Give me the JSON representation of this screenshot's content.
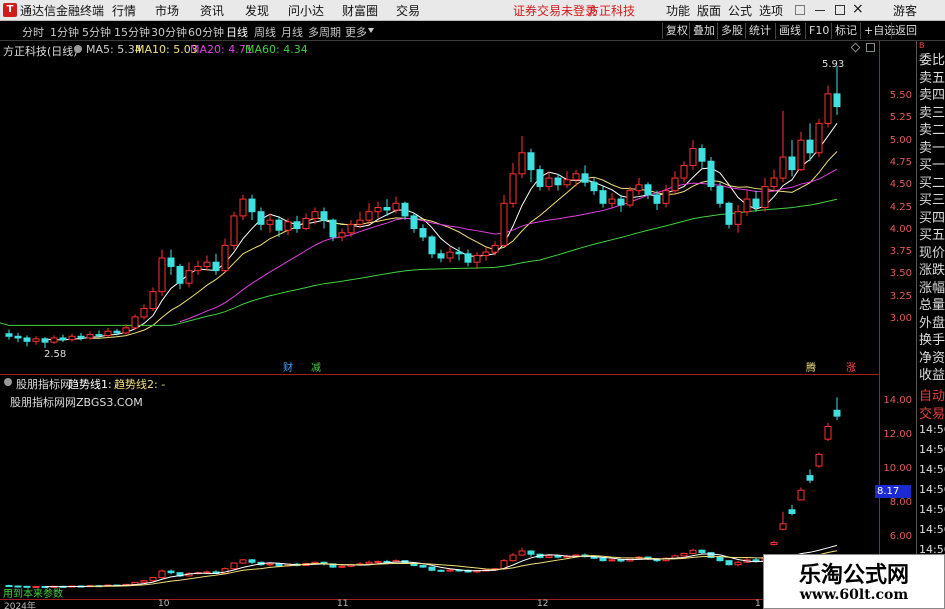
{
  "app": {
    "title": "通达信金融终端",
    "menu": [
      "行情",
      "市场",
      "资讯",
      "发现",
      "问小达",
      "财富圈",
      "交易"
    ],
    "warning": "证券交易未登录",
    "broker": "方正科技",
    "right_menu": [
      "功能",
      "版面",
      "公式",
      "选项"
    ],
    "user": "游客"
  },
  "toolbar": {
    "periods": [
      "分时",
      "1分钟",
      "5分钟",
      "15分钟",
      "30分钟",
      "60分钟",
      "日线",
      "周线",
      "月线",
      "多周期",
      "更多"
    ],
    "active": "日线",
    "buttons": [
      "复权",
      "叠加",
      "多股",
      "统计",
      "画线",
      "F10",
      "标记",
      "+自选",
      "返回"
    ]
  },
  "main": {
    "stock_label": "方正科技(日线)",
    "ma": [
      {
        "label": "MA5: 5.34",
        "color": "#ffffff"
      },
      {
        "label": "MA10: 5.03",
        "color": "#f2e07a"
      },
      {
        "label": "MA20: 4.71",
        "color": "#e040e0"
      },
      {
        "label": "MA60: 4.34",
        "color": "#40d040"
      }
    ],
    "high_label": "5.93",
    "low_label": "2.58",
    "markers": [
      {
        "text": "财",
        "color": "#40a0ff"
      },
      {
        "text": "减",
        "color": "#40d040"
      },
      {
        "text": "腾",
        "color": "#f2e07a"
      },
      {
        "text": "涨",
        "color": "#ff5050"
      }
    ],
    "yticks": [
      "5.50",
      "5.25",
      "5.00",
      "4.75",
      "4.50",
      "4.25",
      "4.00",
      "3.75",
      "3.50",
      "3.25",
      "3.00"
    ]
  },
  "sub": {
    "indicator": "股朋指标网",
    "line1": "趋势线1: -",
    "line2": "趋势线2: -",
    "site": "股朋指标网网ZBGS3.COM",
    "value_tag": "8.17",
    "yticks": [
      "14.00",
      "12.00",
      "10.00",
      "8.00",
      "6.00"
    ],
    "bottom_text": "用到本来参数"
  },
  "dates": [
    "2024年",
    "10",
    "11",
    "12",
    "1"
  ],
  "right_panel": {
    "items": [
      "委比",
      "卖五",
      "卖四",
      "卖三",
      "卖二",
      "卖一",
      "买一",
      "买二",
      "买三",
      "买四",
      "买五",
      "现价",
      "涨跌",
      "涨幅",
      "总量",
      "外盘",
      "换手",
      "净资",
      "收益"
    ],
    "lower": [
      "自动",
      "交易"
    ],
    "times": [
      "14:56",
      "14:56",
      "14:56",
      "14:56",
      "14:56",
      "14:56",
      "14:56",
      "14:56"
    ]
  },
  "watermark": {
    "title": "乐淘公式网",
    "url": "www.60lt.com"
  },
  "chart_data": {
    "type": "candlestick",
    "colors": {
      "up": "#ff3030",
      "down": "#40e0e0"
    },
    "candles": [
      [
        2.75,
        2.72,
        2.8,
        2.68
      ],
      [
        2.72,
        2.7,
        2.76,
        2.65
      ],
      [
        2.7,
        2.66,
        2.73,
        2.6
      ],
      [
        2.66,
        2.69,
        2.72,
        2.62
      ],
      [
        2.69,
        2.65,
        2.71,
        2.58
      ],
      [
        2.65,
        2.7,
        2.73,
        2.63
      ],
      [
        2.7,
        2.68,
        2.74,
        2.65
      ],
      [
        2.68,
        2.72,
        2.75,
        2.66
      ],
      [
        2.72,
        2.7,
        2.76,
        2.67
      ],
      [
        2.7,
        2.74,
        2.78,
        2.68
      ],
      [
        2.74,
        2.73,
        2.79,
        2.7
      ],
      [
        2.73,
        2.78,
        2.82,
        2.71
      ],
      [
        2.78,
        2.76,
        2.81,
        2.73
      ],
      [
        2.76,
        2.82,
        2.86,
        2.74
      ],
      [
        2.82,
        2.95,
        2.98,
        2.8
      ],
      [
        2.95,
        3.05,
        3.1,
        2.92
      ],
      [
        3.05,
        3.25,
        3.3,
        3.02
      ],
      [
        3.25,
        3.65,
        3.75,
        3.2
      ],
      [
        3.65,
        3.55,
        3.75,
        3.45
      ],
      [
        3.55,
        3.35,
        3.58,
        3.28
      ],
      [
        3.35,
        3.5,
        3.6,
        3.3
      ],
      [
        3.5,
        3.55,
        3.62,
        3.45
      ],
      [
        3.55,
        3.6,
        3.68,
        3.5
      ],
      [
        3.6,
        3.5,
        3.7,
        3.45
      ],
      [
        3.5,
        3.8,
        3.88,
        3.48
      ],
      [
        3.8,
        4.15,
        4.2,
        3.75
      ],
      [
        4.15,
        4.35,
        4.4,
        4.1
      ],
      [
        4.35,
        4.2,
        4.4,
        4.1
      ],
      [
        4.2,
        4.05,
        4.25,
        3.98
      ],
      [
        4.05,
        4.1,
        4.18,
        3.95
      ],
      [
        4.1,
        3.98,
        4.15,
        3.9
      ],
      [
        3.98,
        4.08,
        4.12,
        3.92
      ],
      [
        4.08,
        4.0,
        4.15,
        3.95
      ],
      [
        4.0,
        4.12,
        4.18,
        3.98
      ],
      [
        4.12,
        4.2,
        4.25,
        4.05
      ],
      [
        4.2,
        4.1,
        4.25,
        4.0
      ],
      [
        4.1,
        3.9,
        4.12,
        3.85
      ],
      [
        3.9,
        3.95,
        4.0,
        3.85
      ],
      [
        3.95,
        4.05,
        4.1,
        3.9
      ],
      [
        4.05,
        4.1,
        4.2,
        4.0
      ],
      [
        4.1,
        4.2,
        4.3,
        4.05
      ],
      [
        4.2,
        4.25,
        4.32,
        4.12
      ],
      [
        4.25,
        4.22,
        4.35,
        4.15
      ],
      [
        4.22,
        4.3,
        4.38,
        4.18
      ],
      [
        4.3,
        4.15,
        4.32,
        4.1
      ],
      [
        4.15,
        4.0,
        4.18,
        3.95
      ],
      [
        4.0,
        3.9,
        4.05,
        3.85
      ],
      [
        3.9,
        3.7,
        3.92,
        3.65
      ],
      [
        3.7,
        3.65,
        3.75,
        3.6
      ],
      [
        3.65,
        3.72,
        3.78,
        3.6
      ],
      [
        3.72,
        3.7,
        3.78,
        3.62
      ],
      [
        3.7,
        3.6,
        3.75,
        3.55
      ],
      [
        3.6,
        3.68,
        3.72,
        3.52
      ],
      [
        3.68,
        3.72,
        3.78,
        3.62
      ],
      [
        3.72,
        3.8,
        3.85,
        3.68
      ],
      [
        3.8,
        4.3,
        4.4,
        3.78
      ],
      [
        4.3,
        4.65,
        4.78,
        4.25
      ],
      [
        4.65,
        4.9,
        5.1,
        4.6
      ],
      [
        4.9,
        4.7,
        4.95,
        4.55
      ],
      [
        4.7,
        4.5,
        4.75,
        4.45
      ],
      [
        4.5,
        4.6,
        4.68,
        4.45
      ],
      [
        4.6,
        4.52,
        4.65,
        4.45
      ],
      [
        4.52,
        4.58,
        4.68,
        4.48
      ],
      [
        4.58,
        4.65,
        4.7,
        4.5
      ],
      [
        4.65,
        4.55,
        4.75,
        4.5
      ],
      [
        4.55,
        4.45,
        4.6,
        4.4
      ],
      [
        4.45,
        4.3,
        4.5,
        4.25
      ],
      [
        4.3,
        4.35,
        4.42,
        4.25
      ],
      [
        4.35,
        4.28,
        4.4,
        4.2
      ],
      [
        4.28,
        4.45,
        4.5,
        4.25
      ],
      [
        4.45,
        4.52,
        4.6,
        4.4
      ],
      [
        4.52,
        4.4,
        4.55,
        4.35
      ],
      [
        4.4,
        4.3,
        4.45,
        4.22
      ],
      [
        4.3,
        4.45,
        4.52,
        4.25
      ],
      [
        4.45,
        4.6,
        4.68,
        4.4
      ],
      [
        4.6,
        4.75,
        4.8,
        4.55
      ],
      [
        4.75,
        4.95,
        5.05,
        4.7
      ],
      [
        4.95,
        4.8,
        5.0,
        4.72
      ],
      [
        4.8,
        4.5,
        4.85,
        4.45
      ],
      [
        4.5,
        4.3,
        4.55,
        4.25
      ],
      [
        4.3,
        4.05,
        4.32,
        4.0
      ],
      [
        4.05,
        4.2,
        4.28,
        3.95
      ],
      [
        4.2,
        4.35,
        4.45,
        4.15
      ],
      [
        4.35,
        4.25,
        4.45,
        4.2
      ],
      [
        4.25,
        4.5,
        4.6,
        4.2
      ],
      [
        4.5,
        4.6,
        4.7,
        4.45
      ],
      [
        4.6,
        4.85,
        5.4,
        4.55
      ],
      [
        4.85,
        4.7,
        5.05,
        4.62
      ],
      [
        4.7,
        5.05,
        5.15,
        4.68
      ],
      [
        5.05,
        4.9,
        5.25,
        4.8
      ],
      [
        4.9,
        5.25,
        5.3,
        4.85
      ],
      [
        5.25,
        5.6,
        5.7,
        5.2
      ],
      [
        5.6,
        5.45,
        5.93,
        5.35
      ]
    ]
  }
}
